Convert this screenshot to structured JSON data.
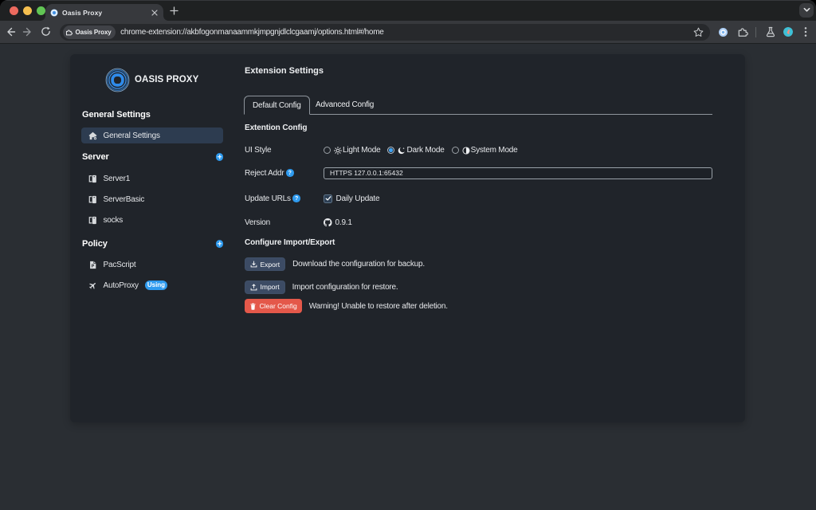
{
  "browser": {
    "tab_title": "Oasis Proxy",
    "omnibox": {
      "chip_label": "Oasis Proxy",
      "url": "chrome-extension://akbfogonmanaammkjmpgnjdlclcgaamj/options.html#/home"
    }
  },
  "colors": {
    "accent": "#2f9bef",
    "danger": "#e4584a",
    "card_bg": "#20242a",
    "page_bg": "#2a2e33",
    "selected_nav": "#2d3c50"
  },
  "sidebar": {
    "logo_text": "OASIS PROXY",
    "section_general": {
      "header": "General Settings",
      "item_general": {
        "label": "General Settings"
      }
    },
    "section_server": {
      "header": "Server",
      "items": [
        {
          "label": "Server1"
        },
        {
          "label": "ServerBasic"
        },
        {
          "label": "socks"
        }
      ]
    },
    "section_policy": {
      "header": "Policy",
      "items": [
        {
          "label": "PacScript"
        },
        {
          "label": "AutoProxy",
          "badge": "Using"
        }
      ]
    }
  },
  "main": {
    "title": "Extension Settings",
    "tabs": [
      {
        "label": "Default Config",
        "active": true
      },
      {
        "label": "Advanced Config",
        "active": false
      }
    ],
    "section_config": {
      "header": "Extention Config",
      "ui_style": {
        "label": "UI Style",
        "options": [
          {
            "label": "Light Mode",
            "selected": false
          },
          {
            "label": "Dark Mode",
            "selected": true
          },
          {
            "label": "System Mode",
            "selected": false
          }
        ]
      },
      "reject_addr": {
        "label": "Reject Addr",
        "value": "HTTPS 127.0.0.1:65432"
      },
      "update_urls": {
        "label": "Update URLs",
        "checkbox_label": "Daily Update",
        "checked": true
      },
      "version": {
        "label": "Version",
        "value": "0.9.1"
      }
    },
    "section_io": {
      "header": "Configure Import/Export",
      "export": {
        "button": "Export",
        "caption": "Download the configuration for backup."
      },
      "import": {
        "button": "Import",
        "caption": "Import configuration for restore."
      },
      "clear": {
        "button": "Clear Config",
        "caption": "Warning! Unable to restore after deletion."
      }
    }
  }
}
